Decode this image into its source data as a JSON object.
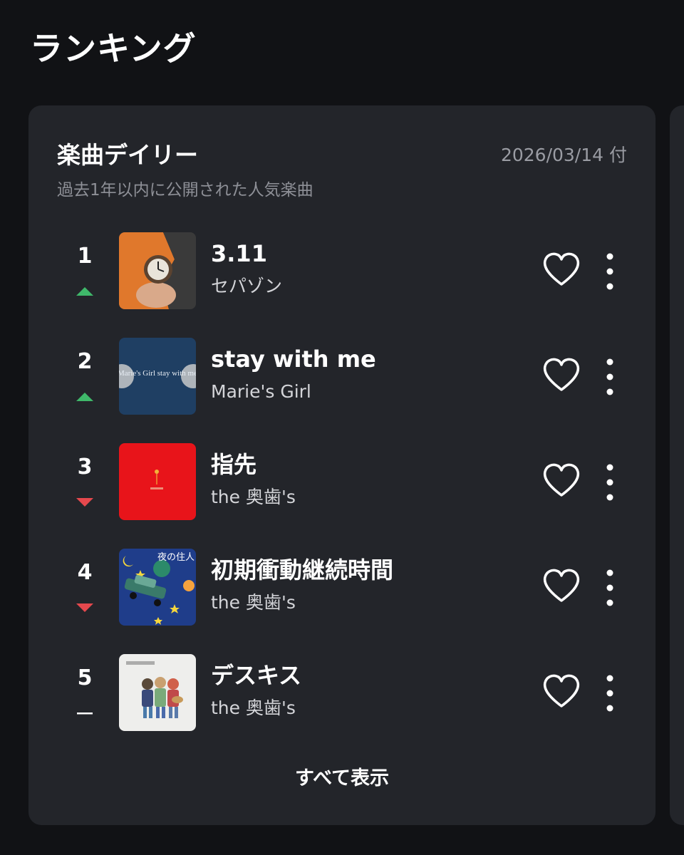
{
  "page": {
    "title": "ランキング"
  },
  "card": {
    "title": "楽曲デイリー",
    "date": "2026/03/14 付",
    "subtitle": "過去1年以内に公開された人気楽曲",
    "show_all_label": "すべて表示"
  },
  "ranking": [
    {
      "rank": "1",
      "title": "3.11",
      "artist": "セパゾン",
      "trend": "up"
    },
    {
      "rank": "2",
      "title": "stay with me",
      "artist": "Marie's Girl",
      "trend": "up"
    },
    {
      "rank": "3",
      "title": "指先",
      "artist": "the 奥歯's",
      "trend": "down"
    },
    {
      "rank": "4",
      "title": "初期衝動継続時間",
      "artist": "the 奥歯's",
      "trend": "down"
    },
    {
      "rank": "5",
      "title": "デスキス",
      "artist": "the 奥歯's",
      "trend": "same"
    }
  ],
  "cover_text": {
    "cover2": "Marie's Girl stay with me",
    "cover4": "夜の住人"
  },
  "icons": {
    "like": "heart-outline-icon",
    "more": "vertical-dots-icon",
    "trend_up": "triangle-up-icon",
    "trend_down": "triangle-down-icon",
    "trend_same": "dash-icon"
  },
  "colors": {
    "background": "#111215",
    "card": "#23252a",
    "trend_up": "#3fb86a",
    "trend_down": "#e5484d",
    "secondary_text": "#9a9ca3"
  }
}
